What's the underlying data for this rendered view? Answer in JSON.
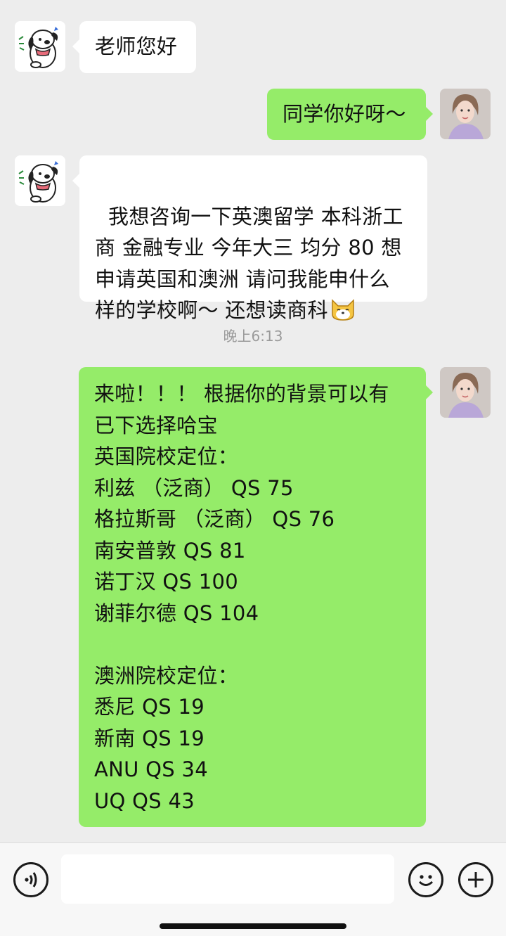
{
  "chat": {
    "msg1": "老师您好",
    "msg2": "同学你好呀～",
    "msg3": "我想咨询一下英澳留学 本科浙工\n商 金融专业 今年大三 均分 80 想\n申请英国和澳洲 请问我能申什么\n样的学校啊～ 还想读商科",
    "time": "晚上6:13",
    "msg4": "来啦！！！ 根据你的背景可以有\n已下选择哈宝\n英国院校定位：\n利兹 （泛商） QS 75\n格拉斯哥 （泛商） QS 76\n南安普敦 QS 81\n诺丁汉 QS 100\n谢菲尔德 QS 104\n\n澳洲院校定位：\n悉尼 QS 19\n新南 QS 19\nANU QS 34\nUQ QS 43"
  },
  "input": {
    "value": ""
  },
  "icons": {
    "voice": "voice-icon",
    "emoji": "emoji-icon",
    "add": "plus-icon",
    "sticker": "cat-emoji"
  },
  "colors": {
    "background": "#ededed",
    "sent_bubble": "#95ec69",
    "received_bubble": "#ffffff"
  }
}
